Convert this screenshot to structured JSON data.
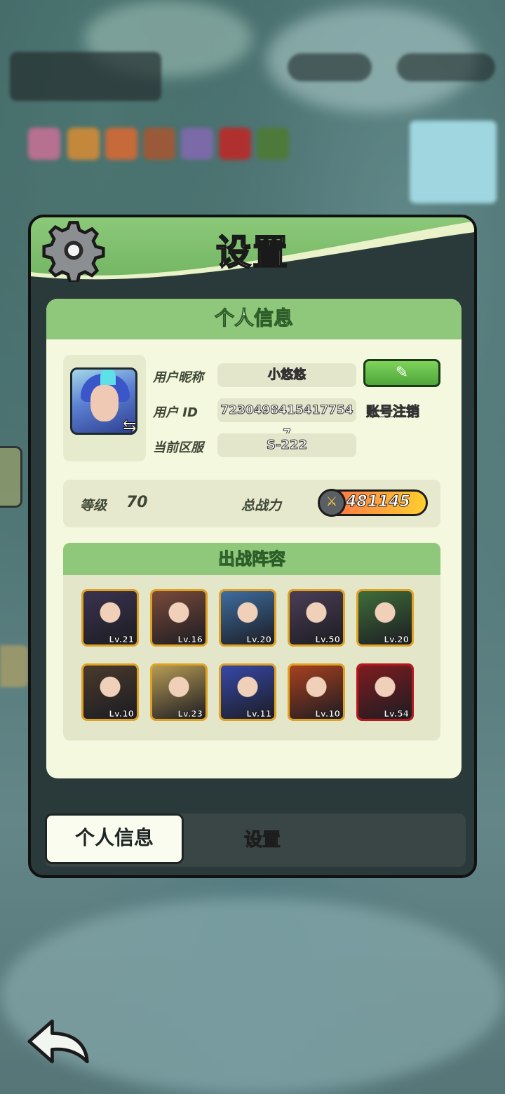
{
  "dialog": {
    "title": "设置",
    "section_title": "个人信息",
    "nickname_label": "用户昵称",
    "nickname_value": "小悠悠",
    "id_label": "用户 ID",
    "id_value": "7230498415417754​7",
    "server_label": "当前区服",
    "server_value": "S-222",
    "cancel_account": "账号注销",
    "level_label": "等级",
    "level_value": "70",
    "power_label": "总战力",
    "power_value": "481145",
    "team_title": "出战阵容",
    "heroes": [
      {
        "level": "Lv.21",
        "color": "#3b3350"
      },
      {
        "level": "Lv.16",
        "color": "#7a4a3a"
      },
      {
        "level": "Lv.20",
        "color": "#3e6da0"
      },
      {
        "level": "Lv.50",
        "color": "#4b3e56"
      },
      {
        "level": "Lv.20",
        "color": "#3f6d3a"
      },
      {
        "level": "Lv.10",
        "color": "#4a3a2c"
      },
      {
        "level": "Lv.23",
        "color": "#b69b54"
      },
      {
        "level": "Lv.11",
        "color": "#3648a8"
      },
      {
        "level": "Lv.10",
        "color": "#a8401f"
      },
      {
        "level": "Lv.54",
        "color": "#7e1c20"
      }
    ]
  },
  "tabs": {
    "active": "个人信息",
    "inactive": "设置"
  },
  "colors": {
    "header_green": "#8cc97a",
    "panel_bg": "#f4f8df",
    "edit_button": "#5cb845",
    "card_border_gold": "#e0a224",
    "card_border_red": "#b8181c"
  }
}
